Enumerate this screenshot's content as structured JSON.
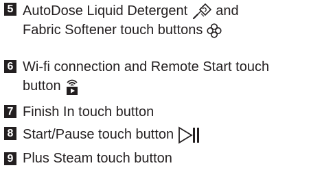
{
  "items": [
    {
      "number": "5",
      "line1_before_icon": "AutoDose Liquid Detergent",
      "line1_after_icon": "and",
      "line2": "Fabric Softener touch buttons",
      "icons": [
        "detergent-icon",
        "fabric-softener-icon"
      ]
    },
    {
      "number": "6",
      "line1": "Wi-fi connection and Remote Start touch",
      "line2": "button",
      "icons": [
        "wifi-remote-start-icon"
      ]
    },
    {
      "number": "7",
      "line1": "Finish In touch button"
    },
    {
      "number": "8",
      "line1": "Start/Pause touch button",
      "icons": [
        "start-pause-icon"
      ]
    },
    {
      "number": "9",
      "line1": "Plus Steam touch button"
    }
  ]
}
